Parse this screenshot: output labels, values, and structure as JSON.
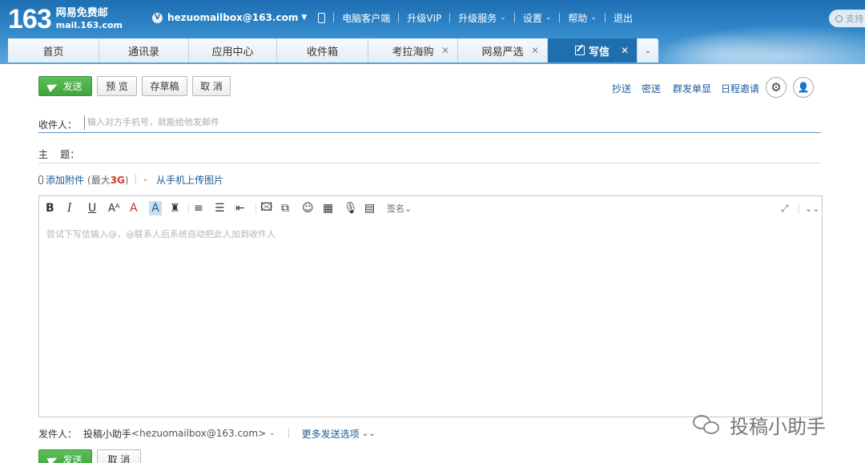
{
  "header": {
    "logo_number": "163",
    "logo_cn": "网易免费邮",
    "logo_domain": "mail.163.com",
    "account_badge": "V",
    "account": "hezuomailbox@163.com",
    "links": [
      "电脑客户端",
      "升级VIP",
      "升级服务",
      "设置",
      "帮助",
      "退出"
    ],
    "search_placeholder": "支持"
  },
  "tabs": [
    {
      "label": "首页"
    },
    {
      "label": "通讯录"
    },
    {
      "label": "应用中心"
    },
    {
      "label": "收件箱"
    },
    {
      "label": "考拉海购",
      "closable": true
    },
    {
      "label": "网易严选",
      "closable": true
    },
    {
      "label": "写信",
      "closable": true,
      "active": true
    }
  ],
  "compose": {
    "send_label": "发送",
    "preview_label": "预 览",
    "draft_label": "存草稿",
    "cancel_label": "取 消",
    "cc_label": "抄送",
    "bcc_label": "密送",
    "group_single_label": "群发单显",
    "schedule_label": "日程邀请",
    "recipient_label": "收件人：",
    "recipient_placeholder": "输入对方手机号，就能给他发邮件",
    "subject_label": "主    题：",
    "attach_label": "添加附件",
    "attach_max_prefix": "(最大",
    "attach_max_value": "3G",
    "attach_max_suffix": ")",
    "mobile_upload_label": "从手机上传图片",
    "editor_placeholder": "尝试下写信输入@，@联系人后系统自动把此人加到收件人",
    "signature_label": "签名",
    "sender_label": "发件人：",
    "sender_name": "投稿小助手",
    "sender_email": "<hezuomailbox@163.com>",
    "more_options_label": "更多发送选项",
    "bottom_send_label": "发送",
    "bottom_cancel_label": "取 消"
  },
  "watermark": "投稿小助手"
}
